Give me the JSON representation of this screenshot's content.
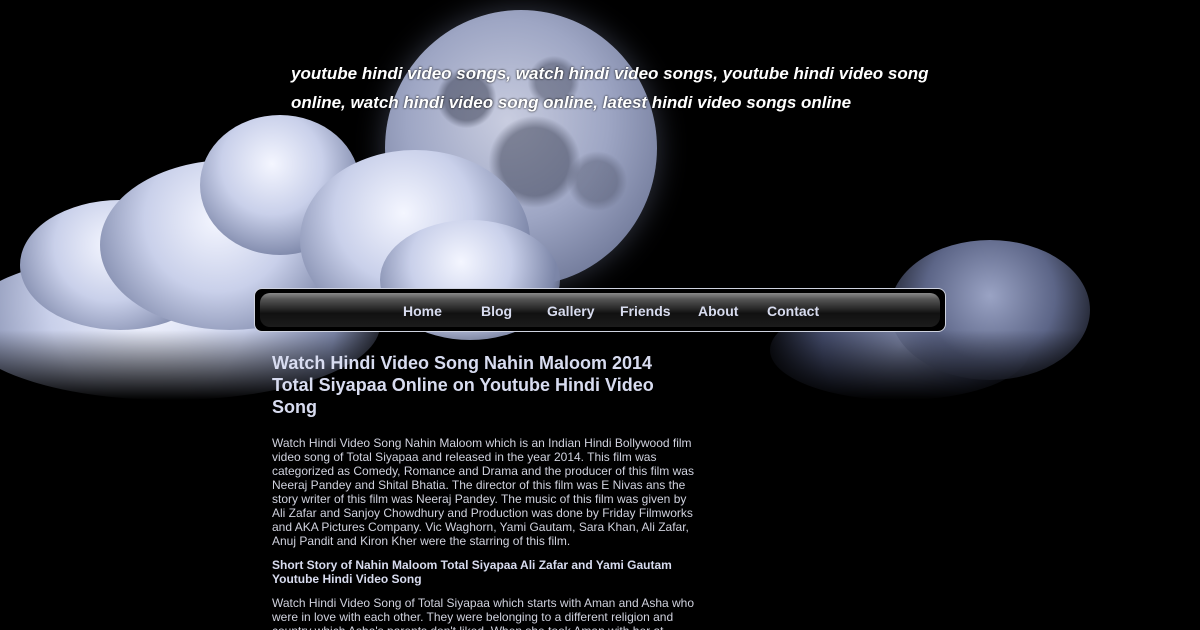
{
  "header": {
    "tagline": "youtube hindi video songs, watch hindi video songs, youtube hindi video song online, watch hindi video song online, latest hindi video songs online"
  },
  "nav": {
    "items": [
      {
        "label": "Home"
      },
      {
        "label": "Blog"
      },
      {
        "label": "Gallery"
      },
      {
        "label": "Friends"
      },
      {
        "label": "About"
      },
      {
        "label": "Contact"
      }
    ]
  },
  "post": {
    "title": "Watch Hindi Video Song Nahin Maloom 2014 Total Siyapaa Online on Youtube Hindi Video Song",
    "paragraph1": "Watch Hindi Video Song Nahin Maloom which is an Indian Hindi Bollywood film video song of Total Siyapaa and released in the year 2014. This film was categorized as Comedy, Romance and Drama and the producer of this film was Neeraj Pandey and Shital Bhatia. The director of this film was E Nivas ans the story writer of this film was Neeraj Pandey. The music of this film was given by Ali Zafar and Sanjoy Chowdhury and Production was done by Friday Filmworks and AKA Pictures Company. Vic Waghorn, Yami Gautam, Sara Khan, Ali Zafar, Anuj Pandit and Kiron Kher were the starring of this film.",
    "subheading": "Short Story of Nahin Maloom Total Siyapaa Ali Zafar and Yami Gautam Youtube Hindi Video Song",
    "paragraph2": "Watch Hindi Video Song of Total Siyapaa which starts with Aman and Asha who were in love with each other. They were belonging to a different religion and country which Asha's parents don't liked. When she took Aman with her at"
  }
}
